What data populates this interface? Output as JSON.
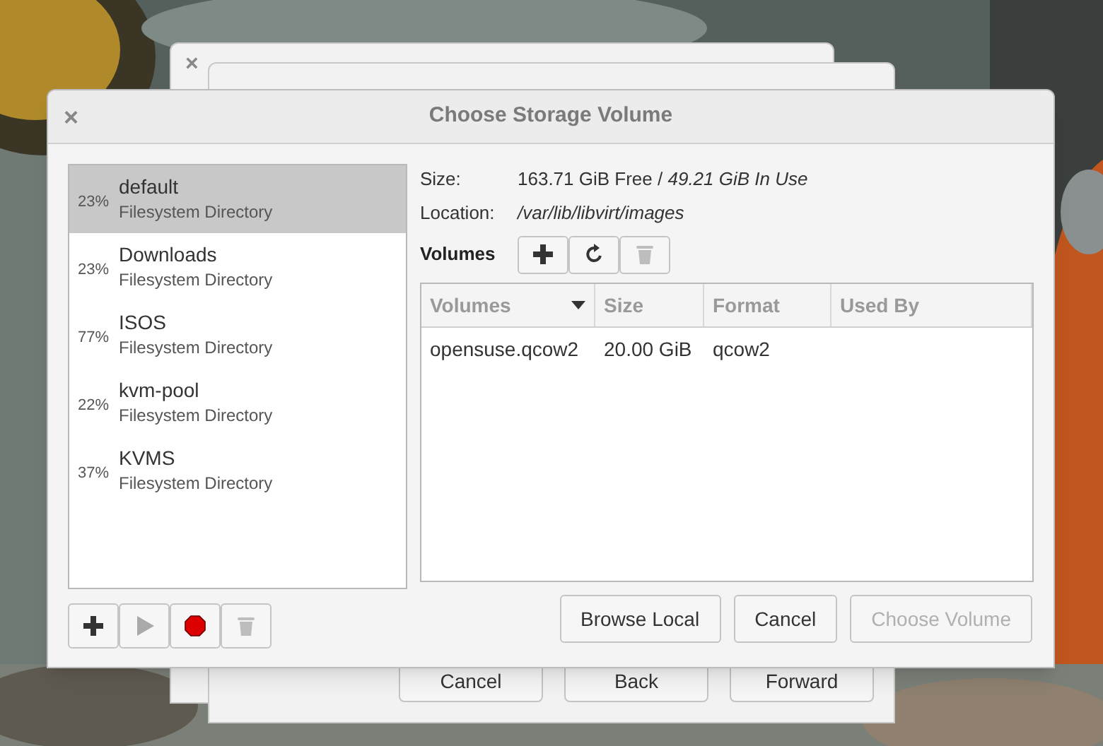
{
  "background_windows": [
    {
      "close": "×"
    },
    {
      "buttons": [
        "Cancel",
        "Back",
        "Forward"
      ]
    }
  ],
  "dialog": {
    "title": "Choose Storage Volume",
    "close": "×"
  },
  "pools": [
    {
      "usage": "23%",
      "name": "default",
      "type": "Filesystem Directory",
      "selected": true
    },
    {
      "usage": "23%",
      "name": "Downloads",
      "type": "Filesystem Directory",
      "selected": false
    },
    {
      "usage": "77%",
      "name": "ISOS",
      "type": "Filesystem Directory",
      "selected": false
    },
    {
      "usage": "22%",
      "name": "kvm-pool",
      "type": "Filesystem Directory",
      "selected": false
    },
    {
      "usage": "37%",
      "name": "KVMS",
      "type": "Filesystem Directory",
      "selected": false
    }
  ],
  "pool_buttons": [
    {
      "kind": "add",
      "disabled": false
    },
    {
      "kind": "start",
      "disabled": true
    },
    {
      "kind": "stop",
      "disabled": false
    },
    {
      "kind": "delete",
      "disabled": true
    }
  ],
  "details": {
    "size_label": "Size:",
    "size_value": "163.71 GiB Free / *49.21 GiB In Use*",
    "location_label": "Location:",
    "location_value": "/var/lib/libvirt/images"
  },
  "volumes_label": "Volumes",
  "volume_buttons": [
    {
      "kind": "add",
      "disabled": false
    },
    {
      "kind": "refresh",
      "disabled": false
    },
    {
      "kind": "delete",
      "disabled": true
    }
  ],
  "table": {
    "columns": [
      {
        "label": "Volumes",
        "sorted": true
      },
      {
        "label": "Size",
        "sorted": false
      },
      {
        "label": "Format",
        "sorted": false
      },
      {
        "label": "Used By",
        "sorted": false
      }
    ],
    "rows": [
      [
        "opensuse.qcow2",
        "20.00 GiB",
        "qcow2",
        null
      ]
    ]
  },
  "buttons": [
    {
      "label": "Browse Local",
      "disabled": false
    },
    {
      "label": "Cancel",
      "disabled": false
    },
    {
      "label": "Choose Volume",
      "disabled": true
    }
  ]
}
